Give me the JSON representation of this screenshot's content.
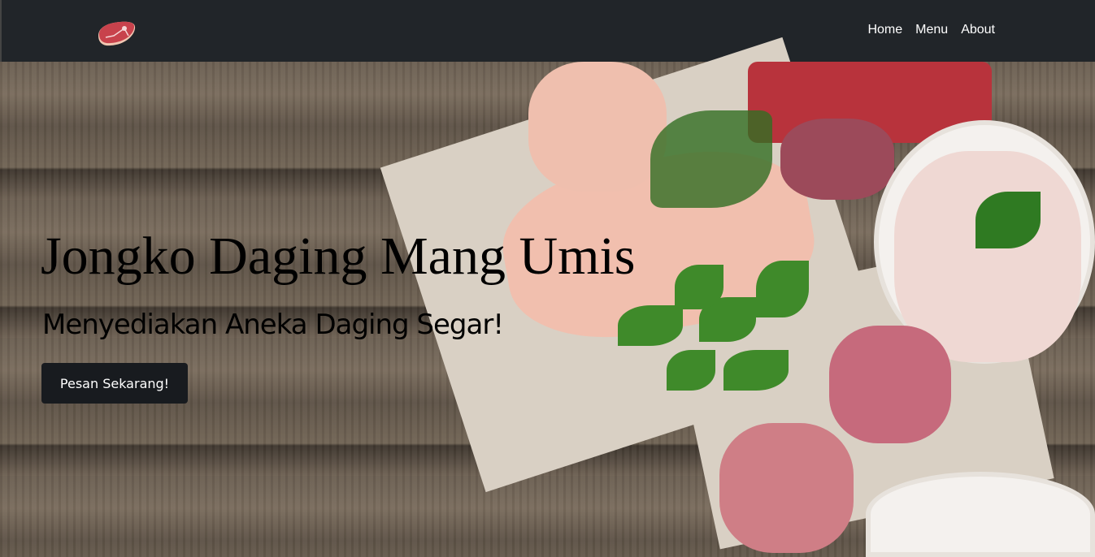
{
  "navbar": {
    "logo_icon": "meat-steak-icon",
    "links": [
      "Home",
      "Menu",
      "About"
    ]
  },
  "hero": {
    "title": "Jongko Daging Mang Umis",
    "subtitle": "Menyediakan Aneka Daging Segar!",
    "cta_label": "Pesan Sekarang!"
  }
}
